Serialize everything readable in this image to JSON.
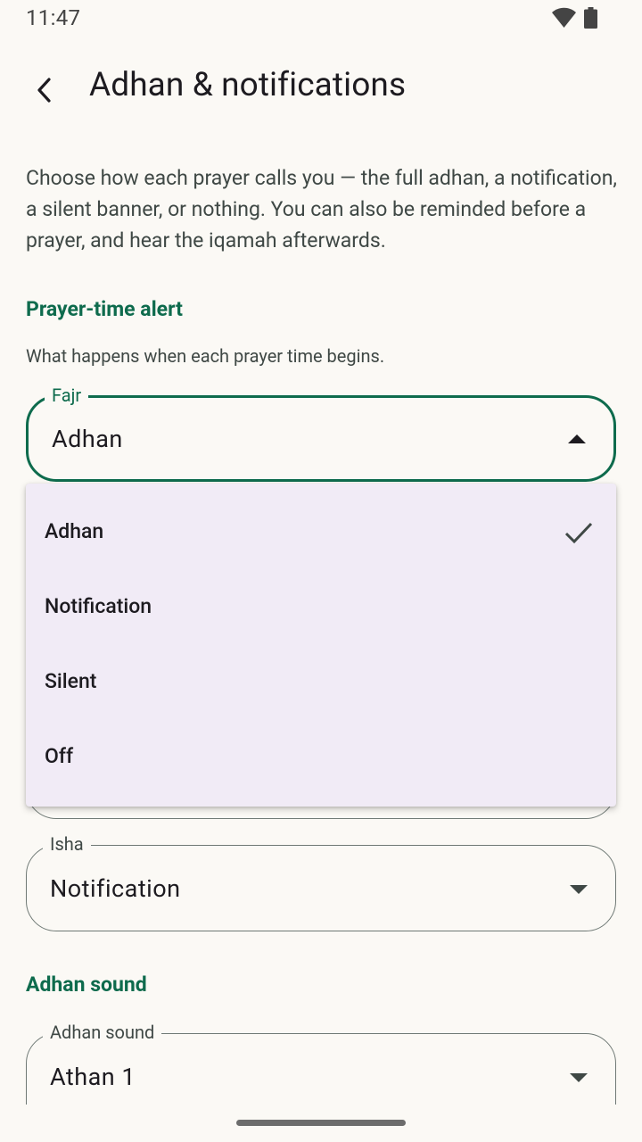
{
  "status_bar": {
    "time": "11:47",
    "wifi_icon": "wifi-icon",
    "battery_icon": "battery-icon"
  },
  "app_bar": {
    "back_icon": "chevron-left-icon",
    "title": "Adhan & notifications"
  },
  "intro": "Choose how each prayer calls you — the full adhan, a notification, a silent banner, or nothing. You can also be reminded before a prayer, and hear the iqamah afterwards.",
  "prayer_alert": {
    "heading": "Prayer-time alert",
    "description": "What happens when each prayer time begins.",
    "fajr": {
      "label": "Fajr",
      "value": "Adhan"
    },
    "isha": {
      "label": "Isha",
      "value": "Notification"
    }
  },
  "menu": {
    "items": [
      {
        "label": "Adhan",
        "selected": true
      },
      {
        "label": "Notification",
        "selected": false
      },
      {
        "label": "Silent",
        "selected": false
      },
      {
        "label": "Off",
        "selected": false
      }
    ]
  },
  "adhan_sound": {
    "heading": "Adhan sound",
    "field": {
      "label": "Adhan sound",
      "value": "Athan 1"
    }
  },
  "colors": {
    "accent": "#0e6b4d",
    "background": "#fbf9f5",
    "menu_background": "#f1ebf6"
  }
}
